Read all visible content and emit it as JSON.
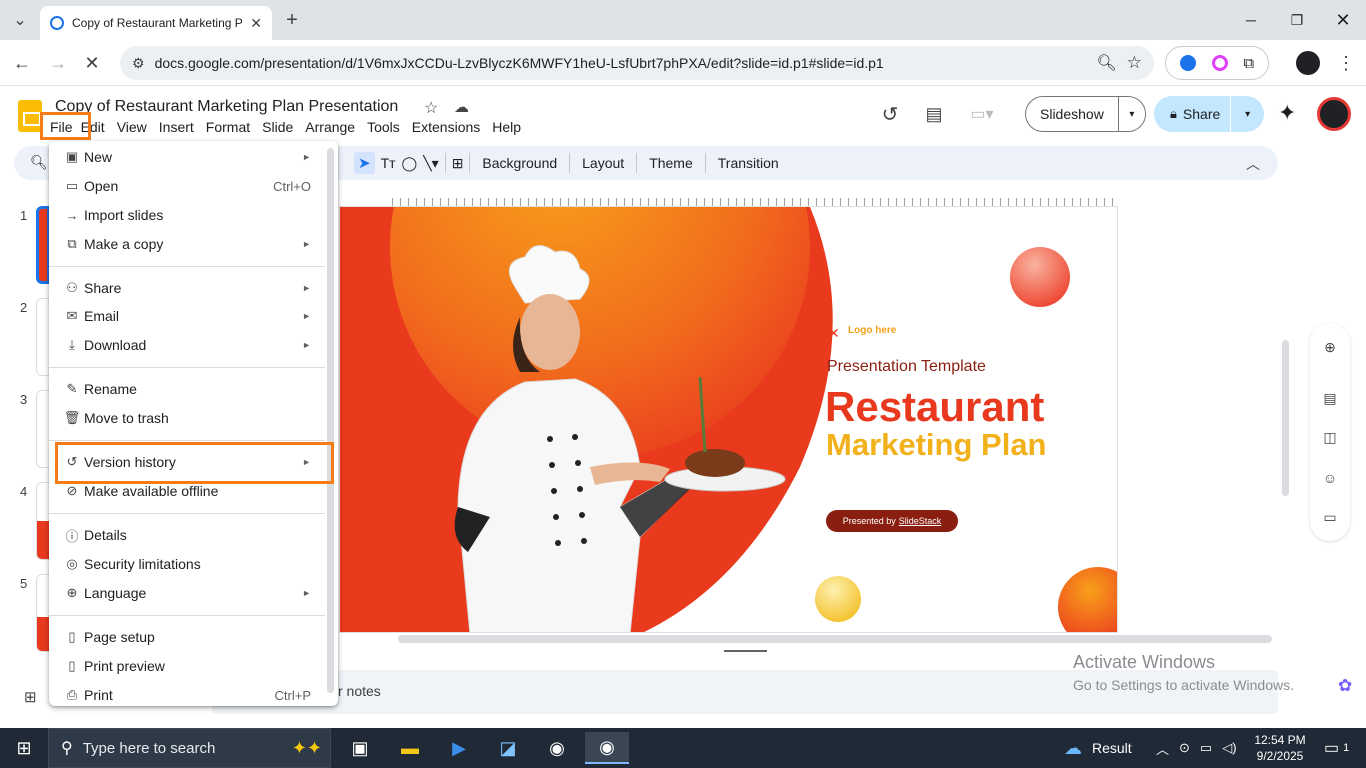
{
  "browser": {
    "tab_title": "Copy of Restaurant Marketing P",
    "new_tab_symbol": "+",
    "url": "docs.google.com/presentation/d/1V6mxJxCCDu-LzvBlyczK6MWFY1heU-LsfUbrt7phPXA/edit?slide=id.p1#slide=id.p1"
  },
  "doc": {
    "title": "Copy of Restaurant Marketing Plan Presentation",
    "menus": [
      "File",
      "Edit",
      "View",
      "Insert",
      "Format",
      "Slide",
      "Arrange",
      "Tools",
      "Extensions",
      "Help"
    ],
    "slideshow_label": "Slideshow",
    "share_label": "Share"
  },
  "toolbar": {
    "background": "Background",
    "layout": "Layout",
    "theme": "Theme",
    "transition": "Transition"
  },
  "filmstrip": [
    "1",
    "2",
    "3",
    "4",
    "5"
  ],
  "file_menu": {
    "new": "New",
    "open": "Open",
    "open_shortcut": "Ctrl+O",
    "import_slides": "Import slides",
    "make_copy": "Make a copy",
    "share": "Share",
    "email": "Email",
    "download": "Download",
    "rename": "Rename",
    "move_to_trash": "Move to trash",
    "version_history": "Version history",
    "make_offline": "Make available offline",
    "details": "Details",
    "security": "Security limitations",
    "language": "Language",
    "page_setup": "Page setup",
    "print_preview": "Print preview",
    "print": "Print",
    "print_shortcut": "Ctrl+P",
    "submenu_arrow": "►"
  },
  "slide": {
    "logo_text": "Logo here",
    "subtitle": "Presentation Template",
    "title_line1": "Restaurant",
    "title_line2": "Marketing Plan",
    "presented_by": "Presented by",
    "presenter": "SlideStack"
  },
  "notes_placeholder": "r notes",
  "watermark": {
    "line1": "Activate Windows",
    "line2": "Go to Settings to activate Windows."
  },
  "taskbar": {
    "search_placeholder": "Type here to search",
    "weather_label": "Result",
    "time": "12:54 PM",
    "date": "9/2/2025",
    "notifications": "1"
  },
  "colors": {
    "highlight": "#f57c16",
    "slide_red": "#e8391e",
    "slide_orange": "#f39c12",
    "title_red": "#e8391e",
    "title_yellow": "#f2b11a",
    "share_bg": "#c2e7ff"
  }
}
